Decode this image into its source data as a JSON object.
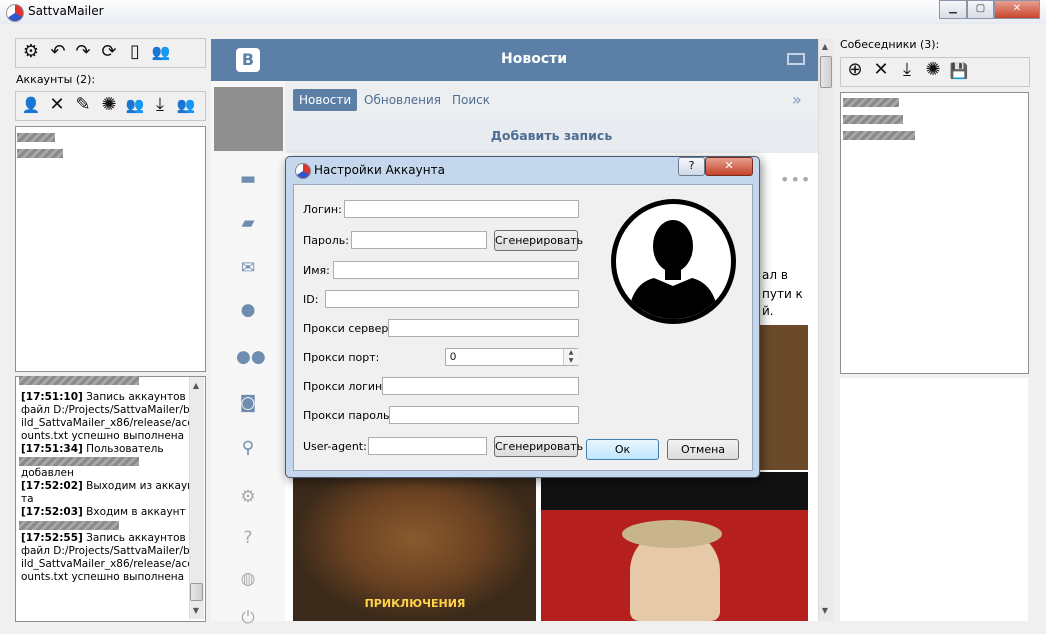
{
  "window": {
    "title": "SattvaMailer",
    "minimize": "▁",
    "maximize": "▢",
    "close": "✕"
  },
  "accounts": {
    "label": "Аккаунты (2):"
  },
  "log": {
    "entries": [
      {
        "time": "[17:51:10]",
        "text": " Запись аккаунтов в файл D:/Projects/SattvaMailer/build_SattvaMailer_x86/release/accounts.txt успешно выполнена"
      },
      {
        "time": "[17:51:34]",
        "text": " Пользователь"
      },
      {
        "time": "",
        "text": "добавлен"
      },
      {
        "time": "[17:52:02]",
        "text": " Выходим из аккаунта"
      },
      {
        "time": "[17:52:03]",
        "text": " Входим в аккаунт"
      },
      {
        "time": "",
        "text": ""
      },
      {
        "time": "[17:52:55]",
        "text": " Запись аккаунтов в файл D:/Projects/SattvaMailer/build_SattvaMailer_x86/release/accounts.txt успешно выполнена"
      }
    ]
  },
  "vk": {
    "logo": "B",
    "title": "Новости",
    "tabs": [
      "Новости",
      "Обновления",
      "Поиск"
    ],
    "add_post": "Добавить запись",
    "post_lines": [
      "ал в",
      "пути к",
      "й."
    ],
    "poster_title": "ПРИКЛЮЧЕНИЯ"
  },
  "contacts": {
    "label": "Собеседники (3):"
  },
  "dialog": {
    "title": "Настройки Аккаунта",
    "help": "?",
    "close": "✕",
    "fields": {
      "login": "Логин:",
      "password": "Пароль:",
      "name": "Имя:",
      "id": "ID:",
      "proxy_server": "Прокси сервер:",
      "proxy_port": "Прокси порт:",
      "proxy_login": "Прокси логин:",
      "proxy_password": "Прокси пароль:",
      "user_agent": "User-agent:"
    },
    "proxy_port_value": "0",
    "generate": "Сгенерировать",
    "ok": "Ок",
    "cancel": "Отмена"
  },
  "icons": {
    "settings": "⚙",
    "undo": "↶",
    "redo": "↷",
    "refresh": "⟳",
    "phone": "▯",
    "users": "👥",
    "user": "👤",
    "delete": "✕",
    "edit": "✎",
    "loading": "✺",
    "download": "⤓",
    "add": "⊕",
    "save": "💾"
  }
}
